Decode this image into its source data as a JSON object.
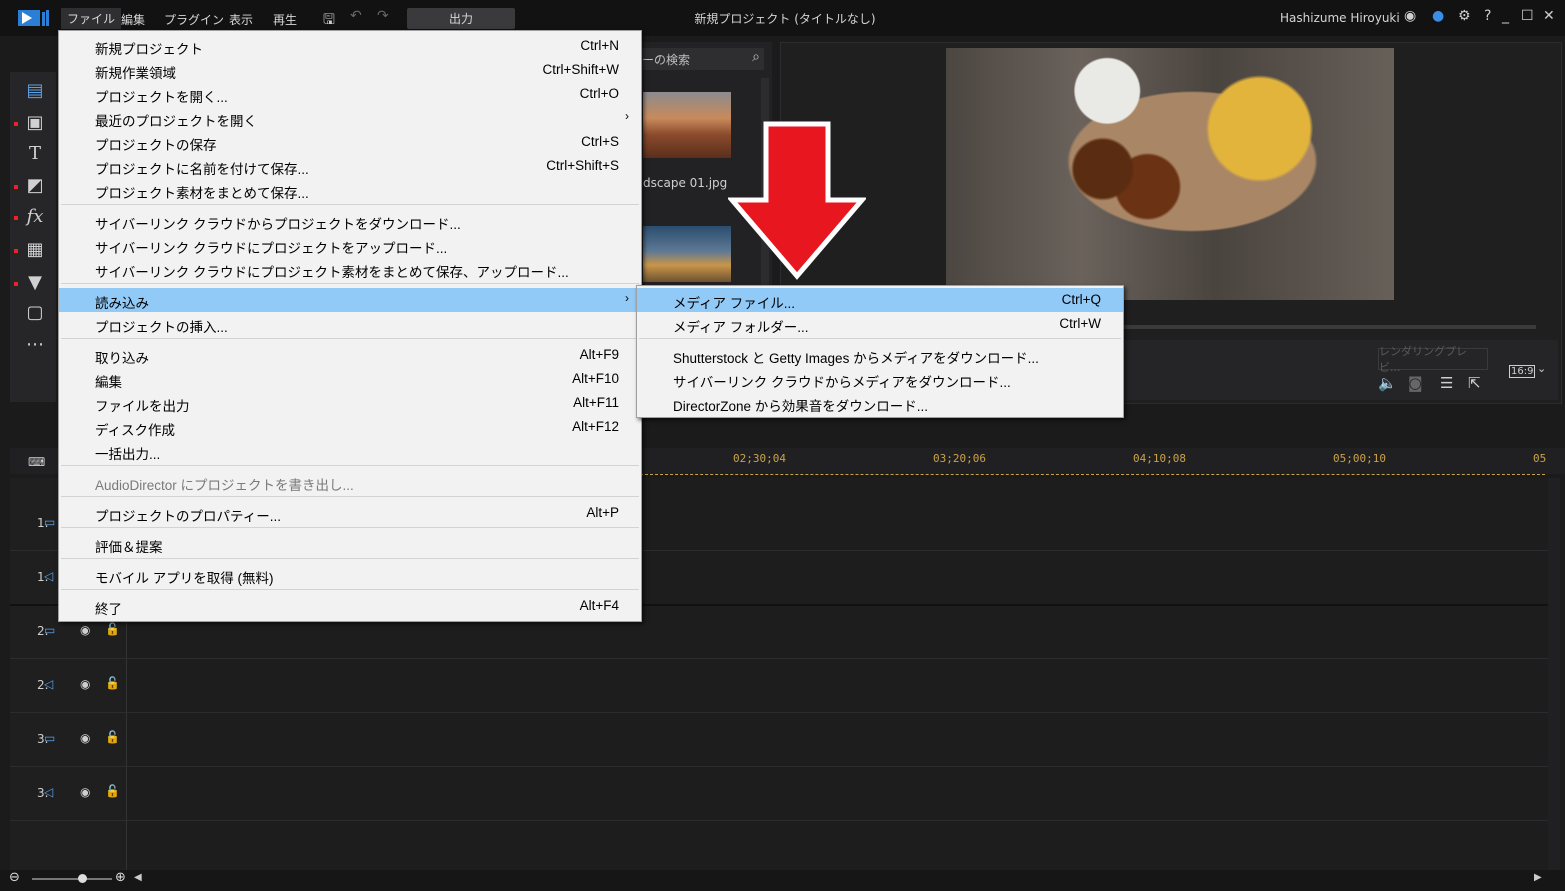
{
  "titlebar": {
    "menus": [
      "ファイル",
      "編集",
      "プラグイン",
      "表示",
      "再生"
    ],
    "export_tab": "出力",
    "window_title": "新規プロジェクト (タイトルなし)",
    "user": "Hashizume Hiroyuki"
  },
  "library": {
    "search_placeholder": "ーの検索",
    "thumb_label": "dscape 01.jpg"
  },
  "preview": {
    "render_button": "レンダリングプレビ...",
    "aspect": "16:9"
  },
  "timeline": {
    "timecodes": [
      "02;30;04",
      "03;20;06",
      "04;10;08",
      "05;00;10",
      "05"
    ],
    "tracks": [
      "1.",
      "1.",
      "2.",
      "2.",
      "3.",
      "3."
    ]
  },
  "file_menu": {
    "new_project": {
      "label": "新規プロジェクト",
      "shortcut": "Ctrl+N"
    },
    "new_workspace": {
      "label": "新規作業領域",
      "shortcut": "Ctrl+Shift+W"
    },
    "open_project": {
      "label": "プロジェクトを開く...",
      "shortcut": "Ctrl+O"
    },
    "recent_projects": {
      "label": "最近のプロジェクトを開く"
    },
    "save_project": {
      "label": "プロジェクトの保存",
      "shortcut": "Ctrl+S"
    },
    "save_as": {
      "label": "プロジェクトに名前を付けて保存...",
      "shortcut": "Ctrl+Shift+S"
    },
    "pack_save": {
      "label": "プロジェクト素材をまとめて保存..."
    },
    "cloud_download": {
      "label": "サイバーリンク クラウドからプロジェクトをダウンロード..."
    },
    "cloud_upload": {
      "label": "サイバーリンク クラウドにプロジェクトをアップロード..."
    },
    "cloud_pack_upload": {
      "label": "サイバーリンク クラウドにプロジェクト素材をまとめて保存、アップロード..."
    },
    "import": {
      "label": "読み込み"
    },
    "insert_project": {
      "label": "プロジェクトの挿入..."
    },
    "capture": {
      "label": "取り込み",
      "shortcut": "Alt+F9"
    },
    "edit": {
      "label": "編集",
      "shortcut": "Alt+F10"
    },
    "produce": {
      "label": "ファイルを出力",
      "shortcut": "Alt+F11"
    },
    "disc": {
      "label": "ディスク作成",
      "shortcut": "Alt+F12"
    },
    "batch": {
      "label": "一括出力..."
    },
    "audiodirector": {
      "label": "AudioDirector にプロジェクトを書き出し..."
    },
    "properties": {
      "label": "プロジェクトのプロパティー...",
      "shortcut": "Alt+P"
    },
    "rate": {
      "label": "評価＆提案"
    },
    "mobile": {
      "label": "モバイル アプリを取得 (無料)"
    },
    "exit": {
      "label": "終了",
      "shortcut": "Alt+F4"
    }
  },
  "import_submenu": {
    "media_file": {
      "label": "メディア ファイル...",
      "shortcut": "Ctrl+Q"
    },
    "media_folder": {
      "label": "メディア フォルダー...",
      "shortcut": "Ctrl+W"
    },
    "shutterstock": {
      "label": "Shutterstock と Getty Images からメディアをダウンロード..."
    },
    "cloud_media": {
      "label": "サイバーリンク クラウドからメディアをダウンロード..."
    },
    "directorzone": {
      "label": "DirectorZone から効果音をダウンロード..."
    }
  },
  "colors": {
    "highlight": "#91c9f7",
    "arrow": "#e8161f",
    "timecode": "#c9a24a"
  }
}
